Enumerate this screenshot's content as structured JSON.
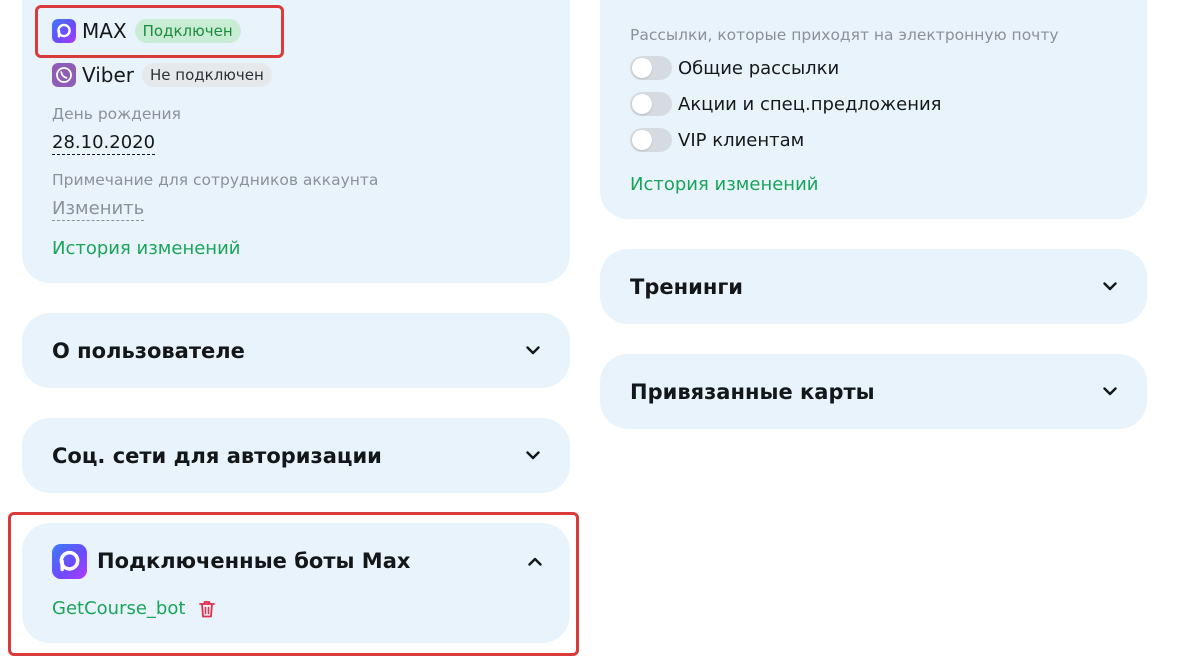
{
  "profile_card": {
    "messengers": [
      {
        "name": "MAX",
        "status": "Подключен",
        "icon": "max-logo-icon"
      },
      {
        "name": "Viber",
        "status": "Не подключен",
        "icon": "viber-icon"
      }
    ],
    "birthday_label": "День рождения",
    "birthday_value": "28.10.2020",
    "note_label": "Примечание для сотрудников аккаунта",
    "note_action": "Изменить",
    "history_link": "История изменений"
  },
  "accordions_left": [
    {
      "title": "О пользователе",
      "expanded": false
    },
    {
      "title": "Соц. сети для авторизации",
      "expanded": false
    }
  ],
  "bots_panel": {
    "title": "Подключенные боты Max",
    "expanded": true,
    "icon": "max-logo-icon",
    "bots": [
      {
        "name": "GetCourse_bot",
        "delete_icon": "trash-icon"
      }
    ]
  },
  "mailing_card": {
    "label": "Рассылки, которые приходят на электронную почту",
    "toggles": [
      {
        "label": "Общие рассылки",
        "on": false
      },
      {
        "label": "Акции и спец.предложения",
        "on": false
      },
      {
        "label": "VIP клиентам",
        "on": false
      }
    ],
    "history_link": "История изменений"
  },
  "accordions_right": [
    {
      "title": "Тренинги",
      "expanded": false
    },
    {
      "title": "Привязанные карты",
      "expanded": false
    }
  ],
  "colors": {
    "card_bg": "#e9f3fb",
    "link_green": "#1aa45b",
    "badge_on_bg": "#c9ecd4",
    "badge_on_text": "#1c8b3e",
    "highlight_red": "#d93a3a",
    "trash_red": "#e0304a"
  }
}
